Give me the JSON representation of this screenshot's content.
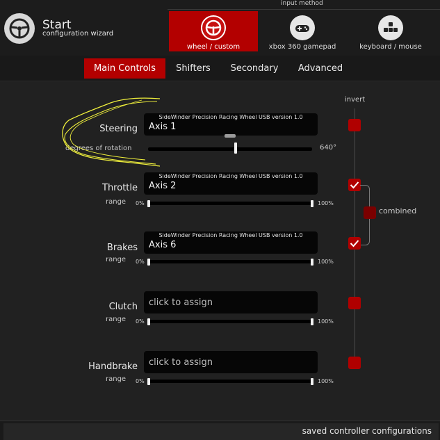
{
  "app": {
    "title": "Start",
    "subtitle": "configuration wizard"
  },
  "input_method": {
    "label": "input method",
    "options": [
      {
        "label": "wheel / custom",
        "selected": true,
        "icon": "steering-wheel-icon"
      },
      {
        "label": "xbox 360 gamepad",
        "selected": false,
        "icon": "gamepad-icon"
      },
      {
        "label": "keyboard / mouse",
        "selected": false,
        "icon": "keyboard-icon"
      }
    ]
  },
  "tabs": [
    {
      "label": "Main Controls",
      "active": true
    },
    {
      "label": "Shifters",
      "active": false
    },
    {
      "label": "Secondary",
      "active": false
    },
    {
      "label": "Advanced",
      "active": false
    }
  ],
  "invert_label": "invert",
  "combined_label": "combined",
  "controls": {
    "steering": {
      "label": "Steering",
      "device": "SideWinder Precision Racing Wheel USB version 1.0",
      "axis": "Axis 1",
      "rotation_label": "degrees of rotation",
      "rotation_value": "640°",
      "invert": false
    },
    "throttle": {
      "label": "Throttle",
      "device": "SideWinder Precision Racing Wheel USB version 1.0",
      "axis": "Axis 2",
      "range_label": "range",
      "range_min": "0%",
      "range_max": "100%",
      "invert": true
    },
    "brakes": {
      "label": "Brakes",
      "device": "SideWinder Precision Racing Wheel USB version 1.0",
      "axis": "Axis 6",
      "range_label": "range",
      "range_min": "0%",
      "range_max": "100%",
      "invert": true
    },
    "clutch": {
      "label": "Clutch",
      "placeholder": "click to assign",
      "range_label": "range",
      "range_min": "0%",
      "range_max": "100%",
      "invert": false
    },
    "handbrake": {
      "label": "Handbrake",
      "placeholder": "click to assign",
      "range_label": "range",
      "range_min": "0%",
      "range_max": "100%",
      "invert": false
    }
  },
  "footer": {
    "saved_label": "saved controller configurations"
  },
  "colors": {
    "accent": "#b30000",
    "annotation": "#f0f03c"
  }
}
